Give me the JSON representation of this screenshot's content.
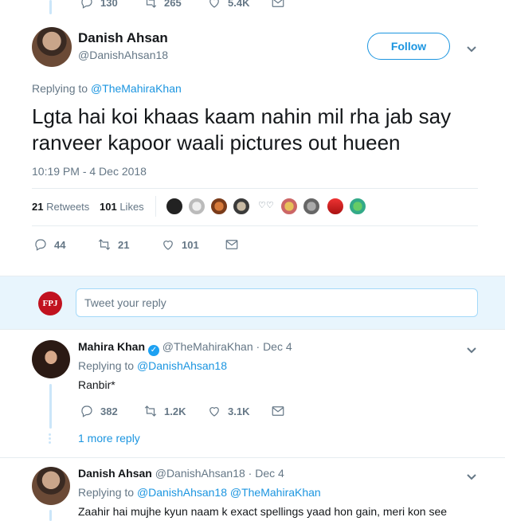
{
  "top_actions": {
    "replies": "130",
    "retweets": "265",
    "likes": "5.4K"
  },
  "main_tweet": {
    "name": "Danish Ahsan",
    "handle": "@DanishAhsan18",
    "follow_label": "Follow",
    "replying_prefix": "Replying to",
    "replying_handle": "@TheMahiraKhan",
    "text_line1": "Lgta hai koi khaas kaam nahin mil rha jab say",
    "text_line2": "ranveer kapoor waali pictures out hueen",
    "timestamp": "10:19 PM - 4 Dec 2018",
    "retweets_count": "21",
    "retweets_label": "Retweets",
    "likes_count": "101",
    "likes_label": "Likes",
    "actions": {
      "replies": "44",
      "retweets": "21",
      "likes": "101"
    }
  },
  "composer": {
    "avatar_text": "FPJ",
    "placeholder": "Tweet your reply"
  },
  "reply1": {
    "name": "Mahira Khan",
    "handle_date": "@TheMahiraKhan · Dec 4",
    "replying_prefix": "Replying to",
    "replying_handle": "@DanishAhsan18",
    "text": "Ranbir*",
    "actions": {
      "replies": "382",
      "retweets": "1.2K",
      "likes": "3.1K"
    },
    "more_replies": "1 more reply"
  },
  "reply2": {
    "name": "Danish Ahsan",
    "handle_date": "@DanishAhsan18 · Dec 4",
    "replying_prefix": "Replying to",
    "replying_handles": "@DanishAhsan18 @TheMahiraKhan",
    "text": "Zaahir hai mujhe kyun naam k exact spellings yaad hon gain, meri kon see"
  },
  "colors": {
    "accent": "#1b95e0",
    "muted": "#657786",
    "thread": "#cbe6f9",
    "verified": "#1da1f2"
  }
}
